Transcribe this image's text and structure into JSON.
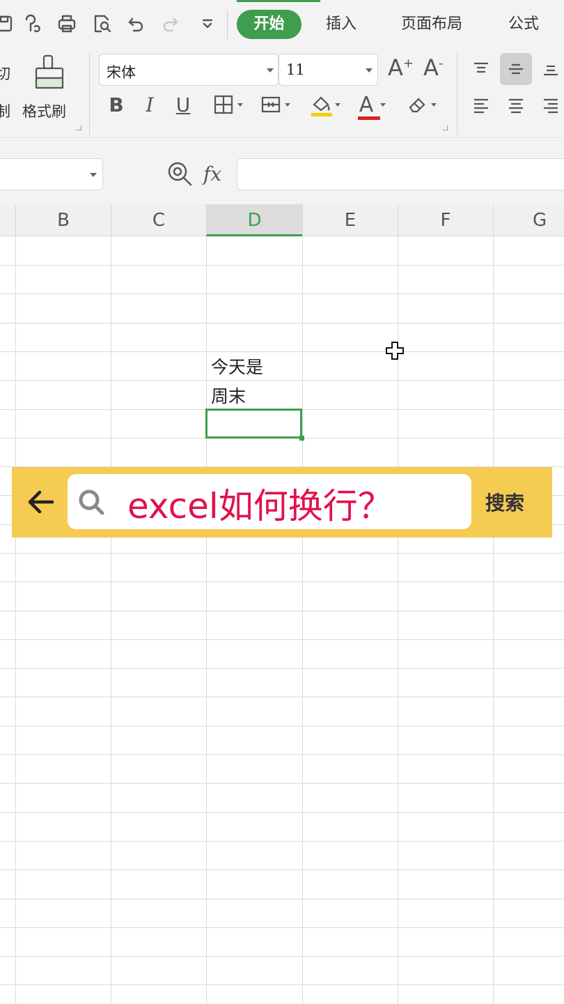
{
  "tabs": [
    {
      "label": "开始",
      "active": true
    },
    {
      "label": "插入",
      "active": false
    },
    {
      "label": "页面布局",
      "active": false
    },
    {
      "label": "公式",
      "active": false
    }
  ],
  "ribbon": {
    "cut_label": "切",
    "copy_label": "制",
    "format_painter_label": "格式刷",
    "font_name": "宋体",
    "font_size": "11",
    "bold_label": "B",
    "italic_label": "I",
    "underline_label": "U",
    "grow_font_label": "A",
    "shrink_font_label": "A",
    "font_color_label": "A"
  },
  "formula_bar": {
    "fx_label": "fx",
    "name_box_value": "",
    "formula_value": ""
  },
  "columns": [
    "B",
    "C",
    "D",
    "E",
    "F",
    "G"
  ],
  "selected_column": "D",
  "cells": {
    "d_line1": "今天是",
    "d_line2": "周末"
  },
  "search": {
    "query": "excel如何换行？",
    "button_label": "搜索"
  },
  "colors": {
    "accent_green": "#3f9d4e",
    "search_bar_yellow": "#f5cb52",
    "query_red": "#e0134a"
  }
}
